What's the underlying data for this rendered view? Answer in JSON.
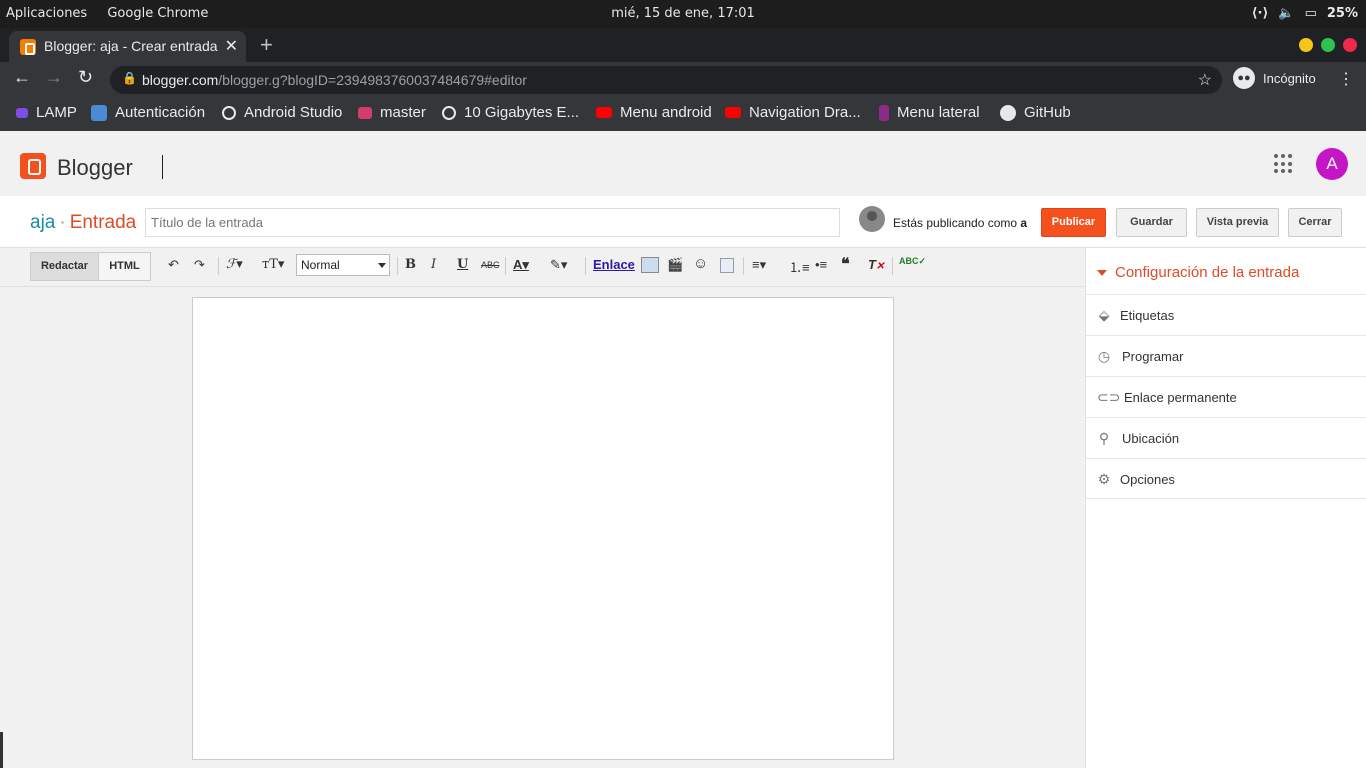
{
  "system_bar": {
    "apps_label": "Aplicaciones",
    "app_name": "Google Chrome",
    "datetime": "mié, 15 de ene, 17:01",
    "battery": "25%"
  },
  "browser": {
    "tab_title": "Blogger: aja - Crear entrada",
    "url_host": "blogger.com",
    "url_path": "/blogger.g?blogID=2394983760037484679#editor",
    "incognito_label": "Incógnito",
    "bookmarks": [
      {
        "label": "LAMP",
        "color": "#7b4ee8"
      },
      {
        "label": "Autenticación",
        "color": "#4b8bd6"
      },
      {
        "label": "Android Studio",
        "color": "#e8e8e8"
      },
      {
        "label": "master",
        "color": "#d43d6b"
      },
      {
        "label": "10 Gigabytes E...",
        "color": "#e8e8e8"
      },
      {
        "label": "Menu android",
        "color": "#ff0000"
      },
      {
        "label": "Navigation Dra...",
        "color": "#ff0000"
      },
      {
        "label": "Menu lateral",
        "color": "#8a2a8a"
      },
      {
        "label": "GitHub",
        "color": "#e8e8e8"
      }
    ]
  },
  "blogger": {
    "brand": "Blogger",
    "avatar_letter": "A",
    "blog_name": "aja",
    "separator": "·",
    "section": "Entrada",
    "title_placeholder": "Título de la entrada",
    "publishing_as_prefix": "Estás publicando como",
    "publishing_as_name": "a",
    "buttons": {
      "publish": "Publicar",
      "save": "Guardar",
      "preview": "Vista previa",
      "close": "Cerrar"
    }
  },
  "toolbar": {
    "compose_mode": "Redactar",
    "html_mode": "HTML",
    "format_select": "Normal",
    "link_label": "Enlace"
  },
  "sidebar": {
    "header": "Configuración de la entrada",
    "items": [
      {
        "label": "Etiquetas",
        "icon": "tag-icon"
      },
      {
        "label": "Programar",
        "icon": "clock-icon"
      },
      {
        "label": "Enlace permanente",
        "icon": "link-icon"
      },
      {
        "label": "Ubicación",
        "icon": "location-pin-icon"
      },
      {
        "label": "Opciones",
        "icon": "gear-icon"
      }
    ]
  },
  "colors": {
    "accent_orange": "#f4511e",
    "blog_name_blue": "#1a8ba8",
    "section_red": "#dd4b27",
    "avatar_purple": "#c516c5"
  }
}
